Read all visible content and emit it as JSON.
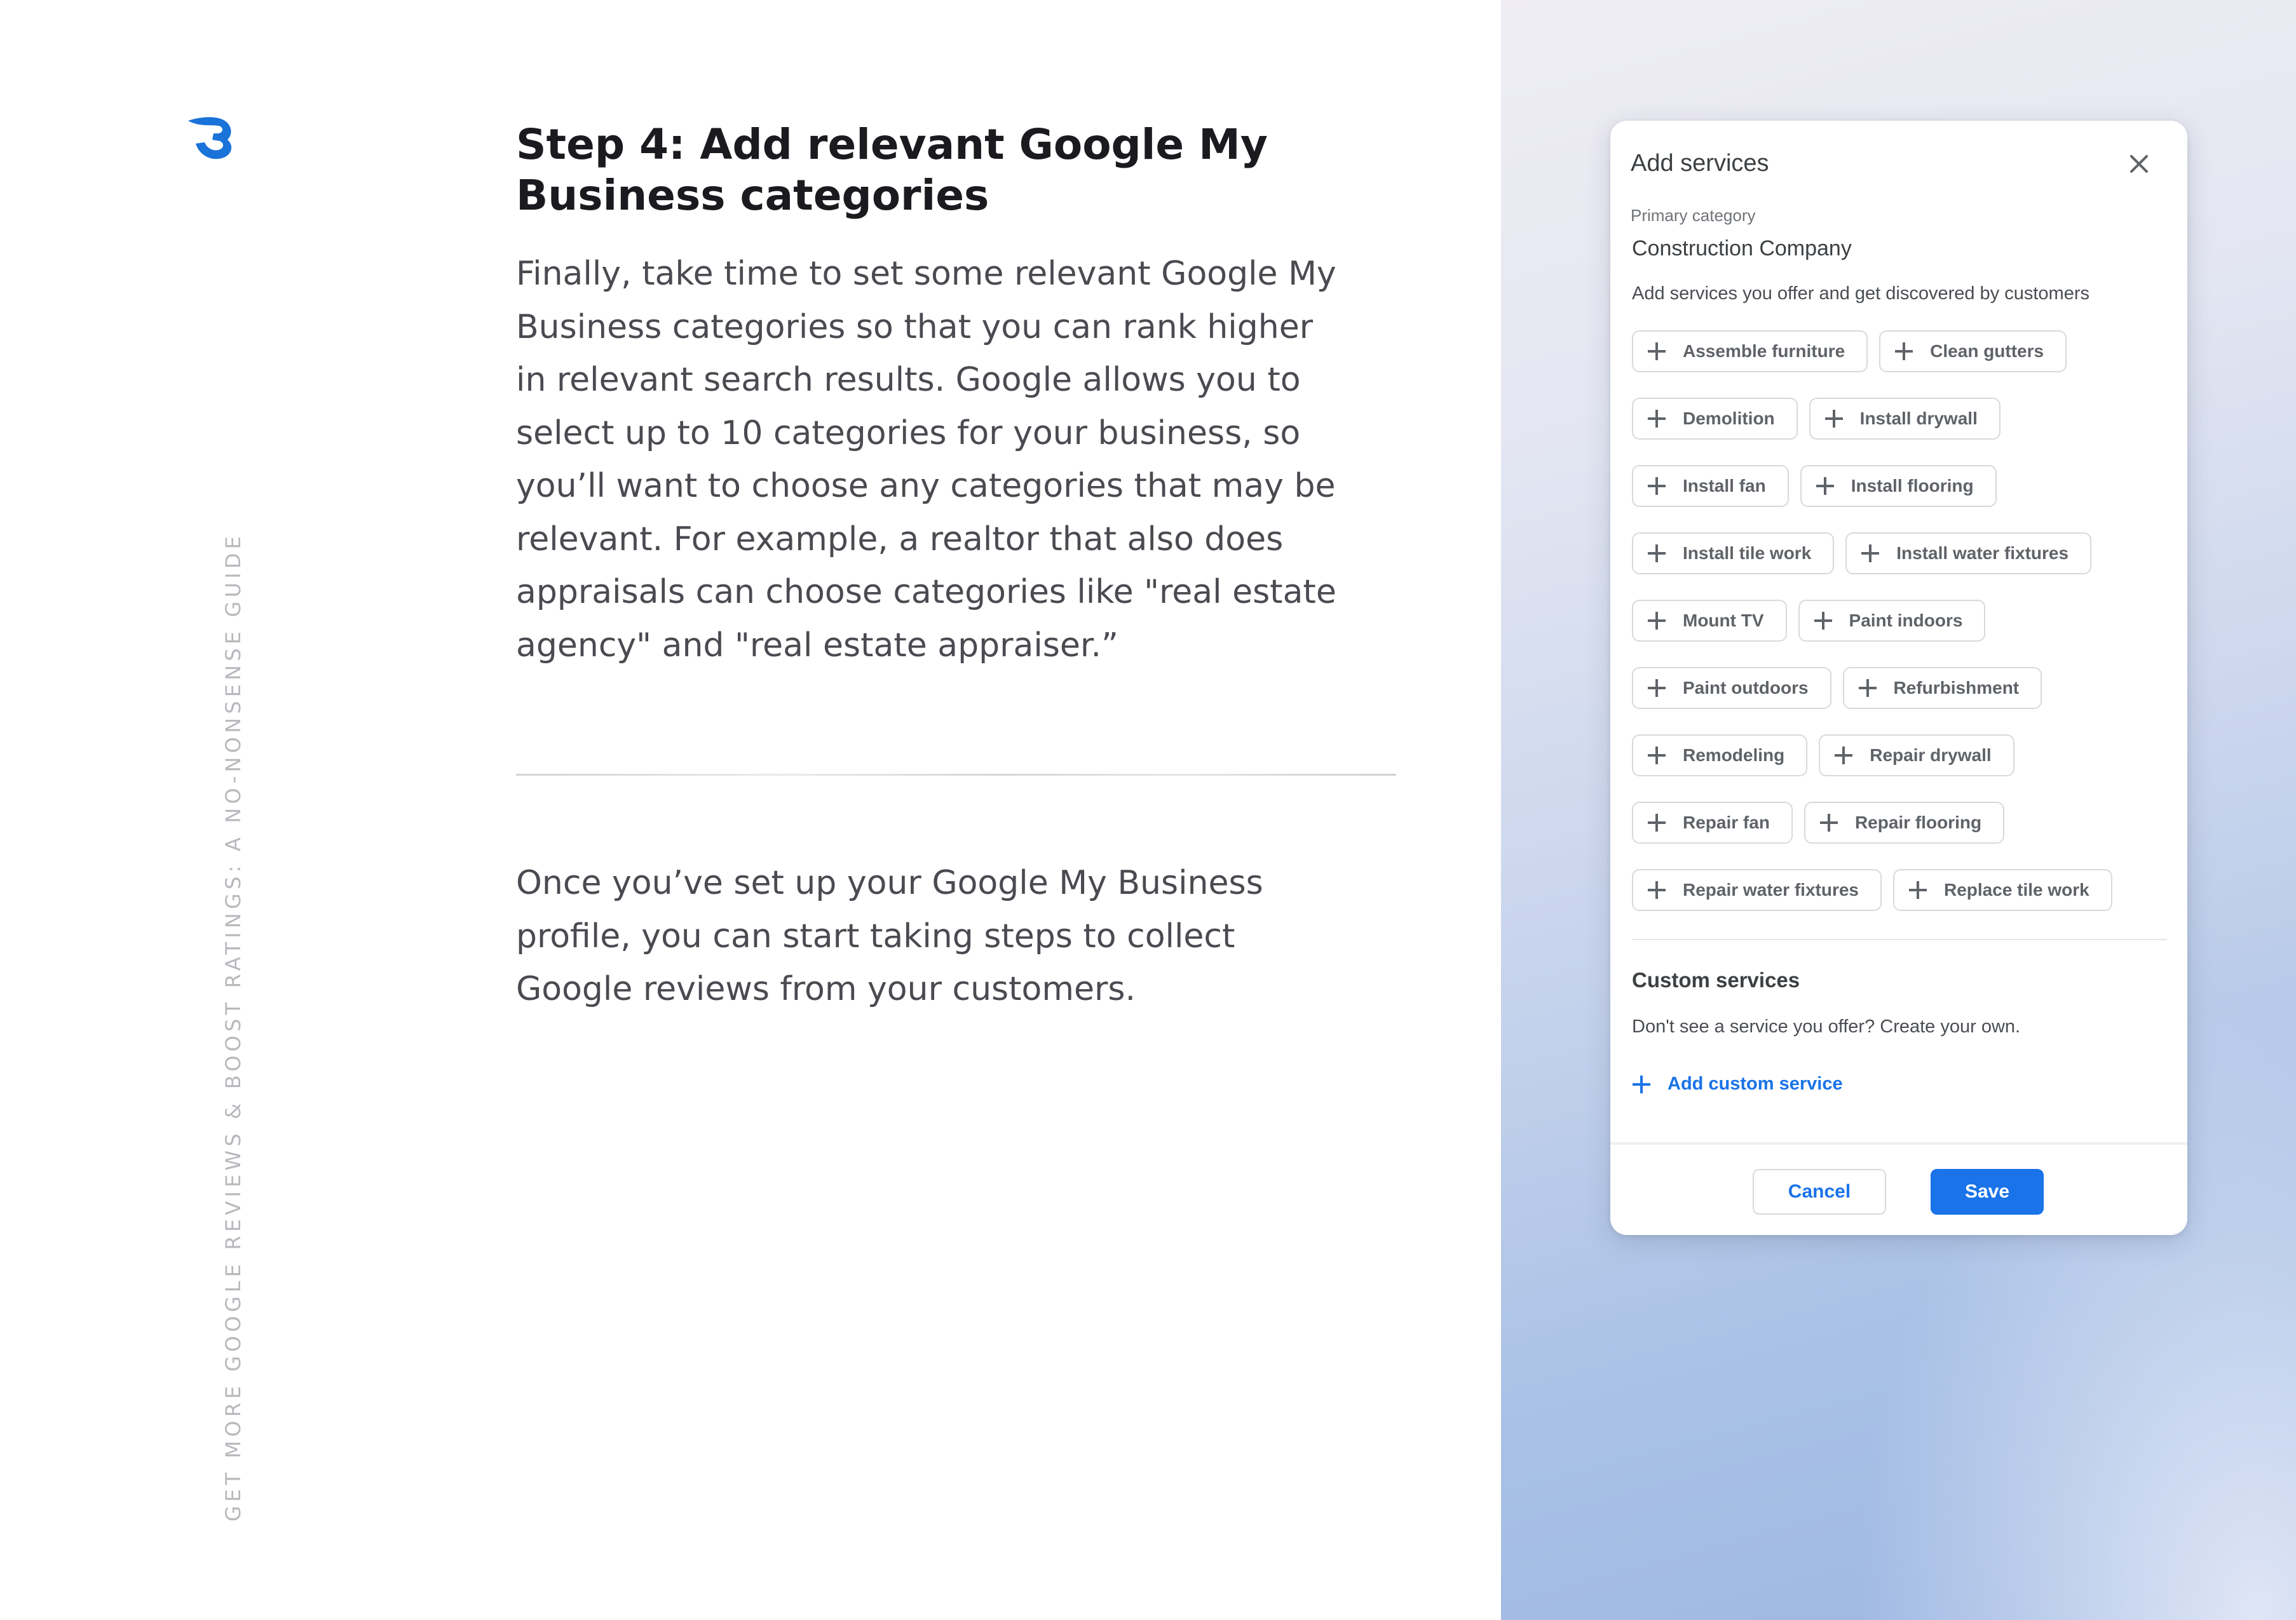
{
  "sidebar": {
    "vertical_text": "GET MORE GOOGLE REVIEWS & BOOST RATINGS: A NO-NONSENSE GUIDE",
    "logo_icon": "brand-logo-icon",
    "logo_color": "#1a73d8"
  },
  "article": {
    "heading_line1": "Step 4: Add relevant Google My",
    "heading_line2": "Business categories",
    "para1_lines": [
      "Finally, take time to set some relevant Google My",
      "Business categories so that you can rank higher",
      "in relevant search results. Google allows you to",
      "select up to 10 categories for your business, so",
      "you’ll want to choose any categories that may be",
      "relevant. For example, a realtor that also does",
      "appraisals can choose categories like \"real estate",
      "agency\" and \"real estate appraiser.”"
    ],
    "para2_lines": [
      "Once you’ve set up your Google My Business",
      "profile, you can start taking steps to collect",
      "Google reviews from your customers."
    ]
  },
  "dialog": {
    "title": "Add services",
    "close_icon": "close-icon",
    "primary_category_label": "Primary category",
    "primary_category_value": "Construction Company",
    "hint": "Add services you offer and get discovered by customers",
    "service_rows": [
      [
        "Assemble furniture",
        "Clean gutters"
      ],
      [
        "Demolition",
        "Install drywall"
      ],
      [
        "Install fan",
        "Install flooring"
      ],
      [
        "Install tile work",
        "Install water fixtures"
      ],
      [
        "Mount TV",
        "Paint indoors"
      ],
      [
        "Paint outdoors",
        "Refurbishment"
      ],
      [
        "Remodeling",
        "Repair drywall"
      ],
      [
        "Repair fan",
        "Repair flooring"
      ],
      [
        "Repair water fixtures",
        "Replace tile work"
      ]
    ],
    "custom_title": "Custom services",
    "custom_hint": "Don't see a service you offer? Create your own.",
    "add_custom_label": "Add custom service",
    "cancel_label": "Cancel",
    "save_label": "Save",
    "accent_color": "#1a73e8"
  }
}
